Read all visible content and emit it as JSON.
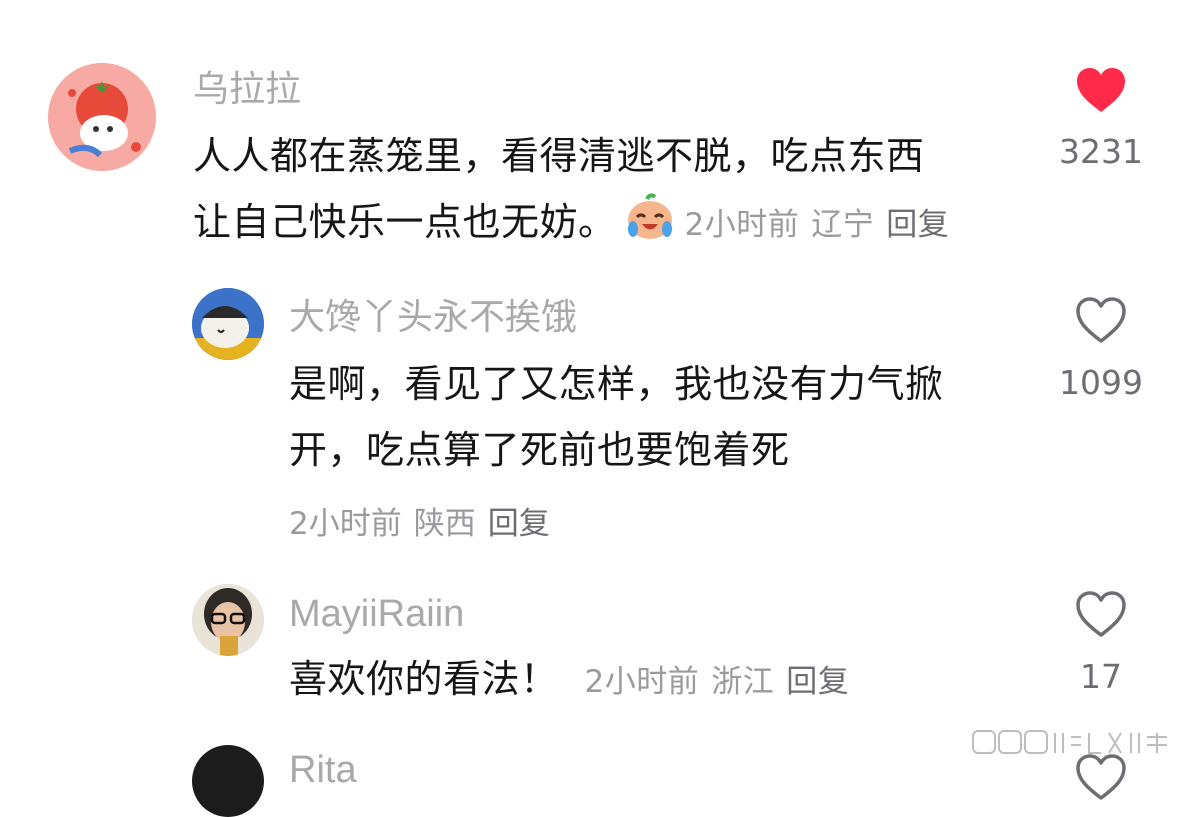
{
  "comments": [
    {
      "username": "乌拉拉",
      "text_lines": [
        "人人都在蒸笼里，看得清逃不脱，吃点东西",
        "让自己快乐一点也无妨。"
      ],
      "emoji": "crying-laugh-emoji",
      "time": "2小时前",
      "location": "辽宁",
      "reply_label": "回复",
      "likes": "3231",
      "liked": true,
      "like_color": "#ff2a4a"
    },
    {
      "username": "大馋丫头永不挨饿",
      "text_lines": [
        "是啊，看见了又怎样，我也没有力气掀",
        "开，吃点算了死前也要饱着死"
      ],
      "time": "2小时前",
      "location": "陕西",
      "reply_label": "回复",
      "likes": "1099",
      "liked": false
    },
    {
      "username": "MayiiRaiin",
      "text_lines": [
        "喜欢你的看法！"
      ],
      "time": "2小时前",
      "location": "浙江",
      "reply_label": "回复",
      "likes": "17",
      "liked": false
    },
    {
      "username": "Rita"
    }
  ],
  "icons": {
    "heart_filled": "heart-filled-icon",
    "heart_outline": "heart-outline-icon"
  }
}
